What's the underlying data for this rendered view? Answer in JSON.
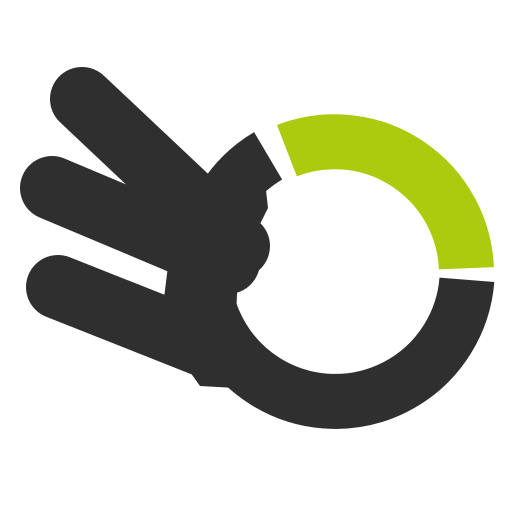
{
  "icon": {
    "name": "ok-hand-gesture-icon",
    "colors": {
      "hand": "#2f2f2f",
      "accent": "#adcb0e",
      "background": "#ffffff"
    },
    "accent_segment_fraction": 0.25
  }
}
